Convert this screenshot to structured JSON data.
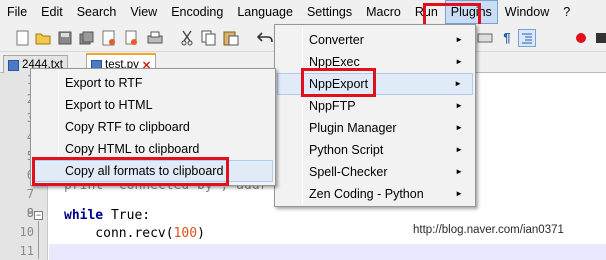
{
  "menubar": {
    "items": [
      "File",
      "Edit",
      "Search",
      "View",
      "Encoding",
      "Language",
      "Settings",
      "Macro",
      "Run",
      "Plugins",
      "Window",
      "?"
    ],
    "active_index": 9
  },
  "tabs": [
    {
      "label": "2444.txt"
    },
    {
      "label": "test.py",
      "close": "✕"
    }
  ],
  "toolbar_icons": [
    "new-file-icon",
    "open-file-icon",
    "save-icon",
    "save-all-icon",
    "close-icon",
    "close-all-icon",
    "print-icon",
    "cut-icon",
    "copy-icon",
    "paste-icon",
    "undo-icon"
  ],
  "toolbar_right_icons": [
    "zoom-icon",
    "paragraph-icon",
    "indent-guide-icon",
    "macro-record-icon",
    "macro-stop-icon"
  ],
  "editor": {
    "line_numbers": [
      "1",
      "2",
      "3",
      "4",
      "5",
      "6",
      "7",
      "8",
      "9",
      "10",
      "11"
    ],
    "lines": {
      "l8_visible": "print  connected by , addr",
      "l9_keyword": "while",
      "l9_rest": " True:",
      "l10_prefix": "    conn.recv(",
      "l10_number": "100",
      "l10_suffix": ")"
    }
  },
  "plugins_menu": {
    "items": [
      {
        "label": "Converter",
        "submenu": true
      },
      {
        "label": "NppExec",
        "submenu": true
      },
      {
        "label": "NppExport",
        "submenu": true
      },
      {
        "label": "NppFTP",
        "submenu": true
      },
      {
        "label": "Plugin Manager",
        "submenu": true
      },
      {
        "label": "Python Script",
        "submenu": true
      },
      {
        "label": "Spell-Checker",
        "submenu": true
      },
      {
        "label": "Zen Coding - Python",
        "submenu": true
      }
    ],
    "arrow": "►"
  },
  "export_menu": {
    "items": [
      {
        "label": "Export to RTF"
      },
      {
        "label": "Export to HTML"
      },
      {
        "label": "Copy RTF to clipboard"
      },
      {
        "label": "Copy HTML to clipboard"
      },
      {
        "label": "Copy all formats to clipboard"
      }
    ]
  },
  "watermark": "http://blog.naver.com/ian0371",
  "colors": {
    "highlight_box": "#e0101c",
    "menu_hover": "#c9def5",
    "keyword": "#00008b",
    "number": "#e0501c"
  }
}
